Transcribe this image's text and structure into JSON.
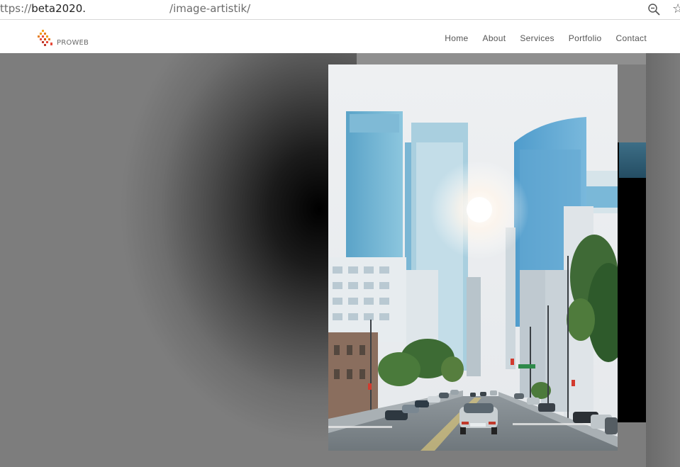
{
  "browser": {
    "url_protocol": "ttps://",
    "url_host": "beta2020.",
    "url_path": "/image-artistik/",
    "zoom_icon": "magnifier-minus-icon",
    "bookmark_icon": "star-icon"
  },
  "site": {
    "logo_text": "PROWEB",
    "nav": [
      "Home",
      "About",
      "Services",
      "Portfolio",
      "Contact"
    ]
  },
  "hero": {
    "image_subject": "city-street-skyscrapers-photo"
  }
}
